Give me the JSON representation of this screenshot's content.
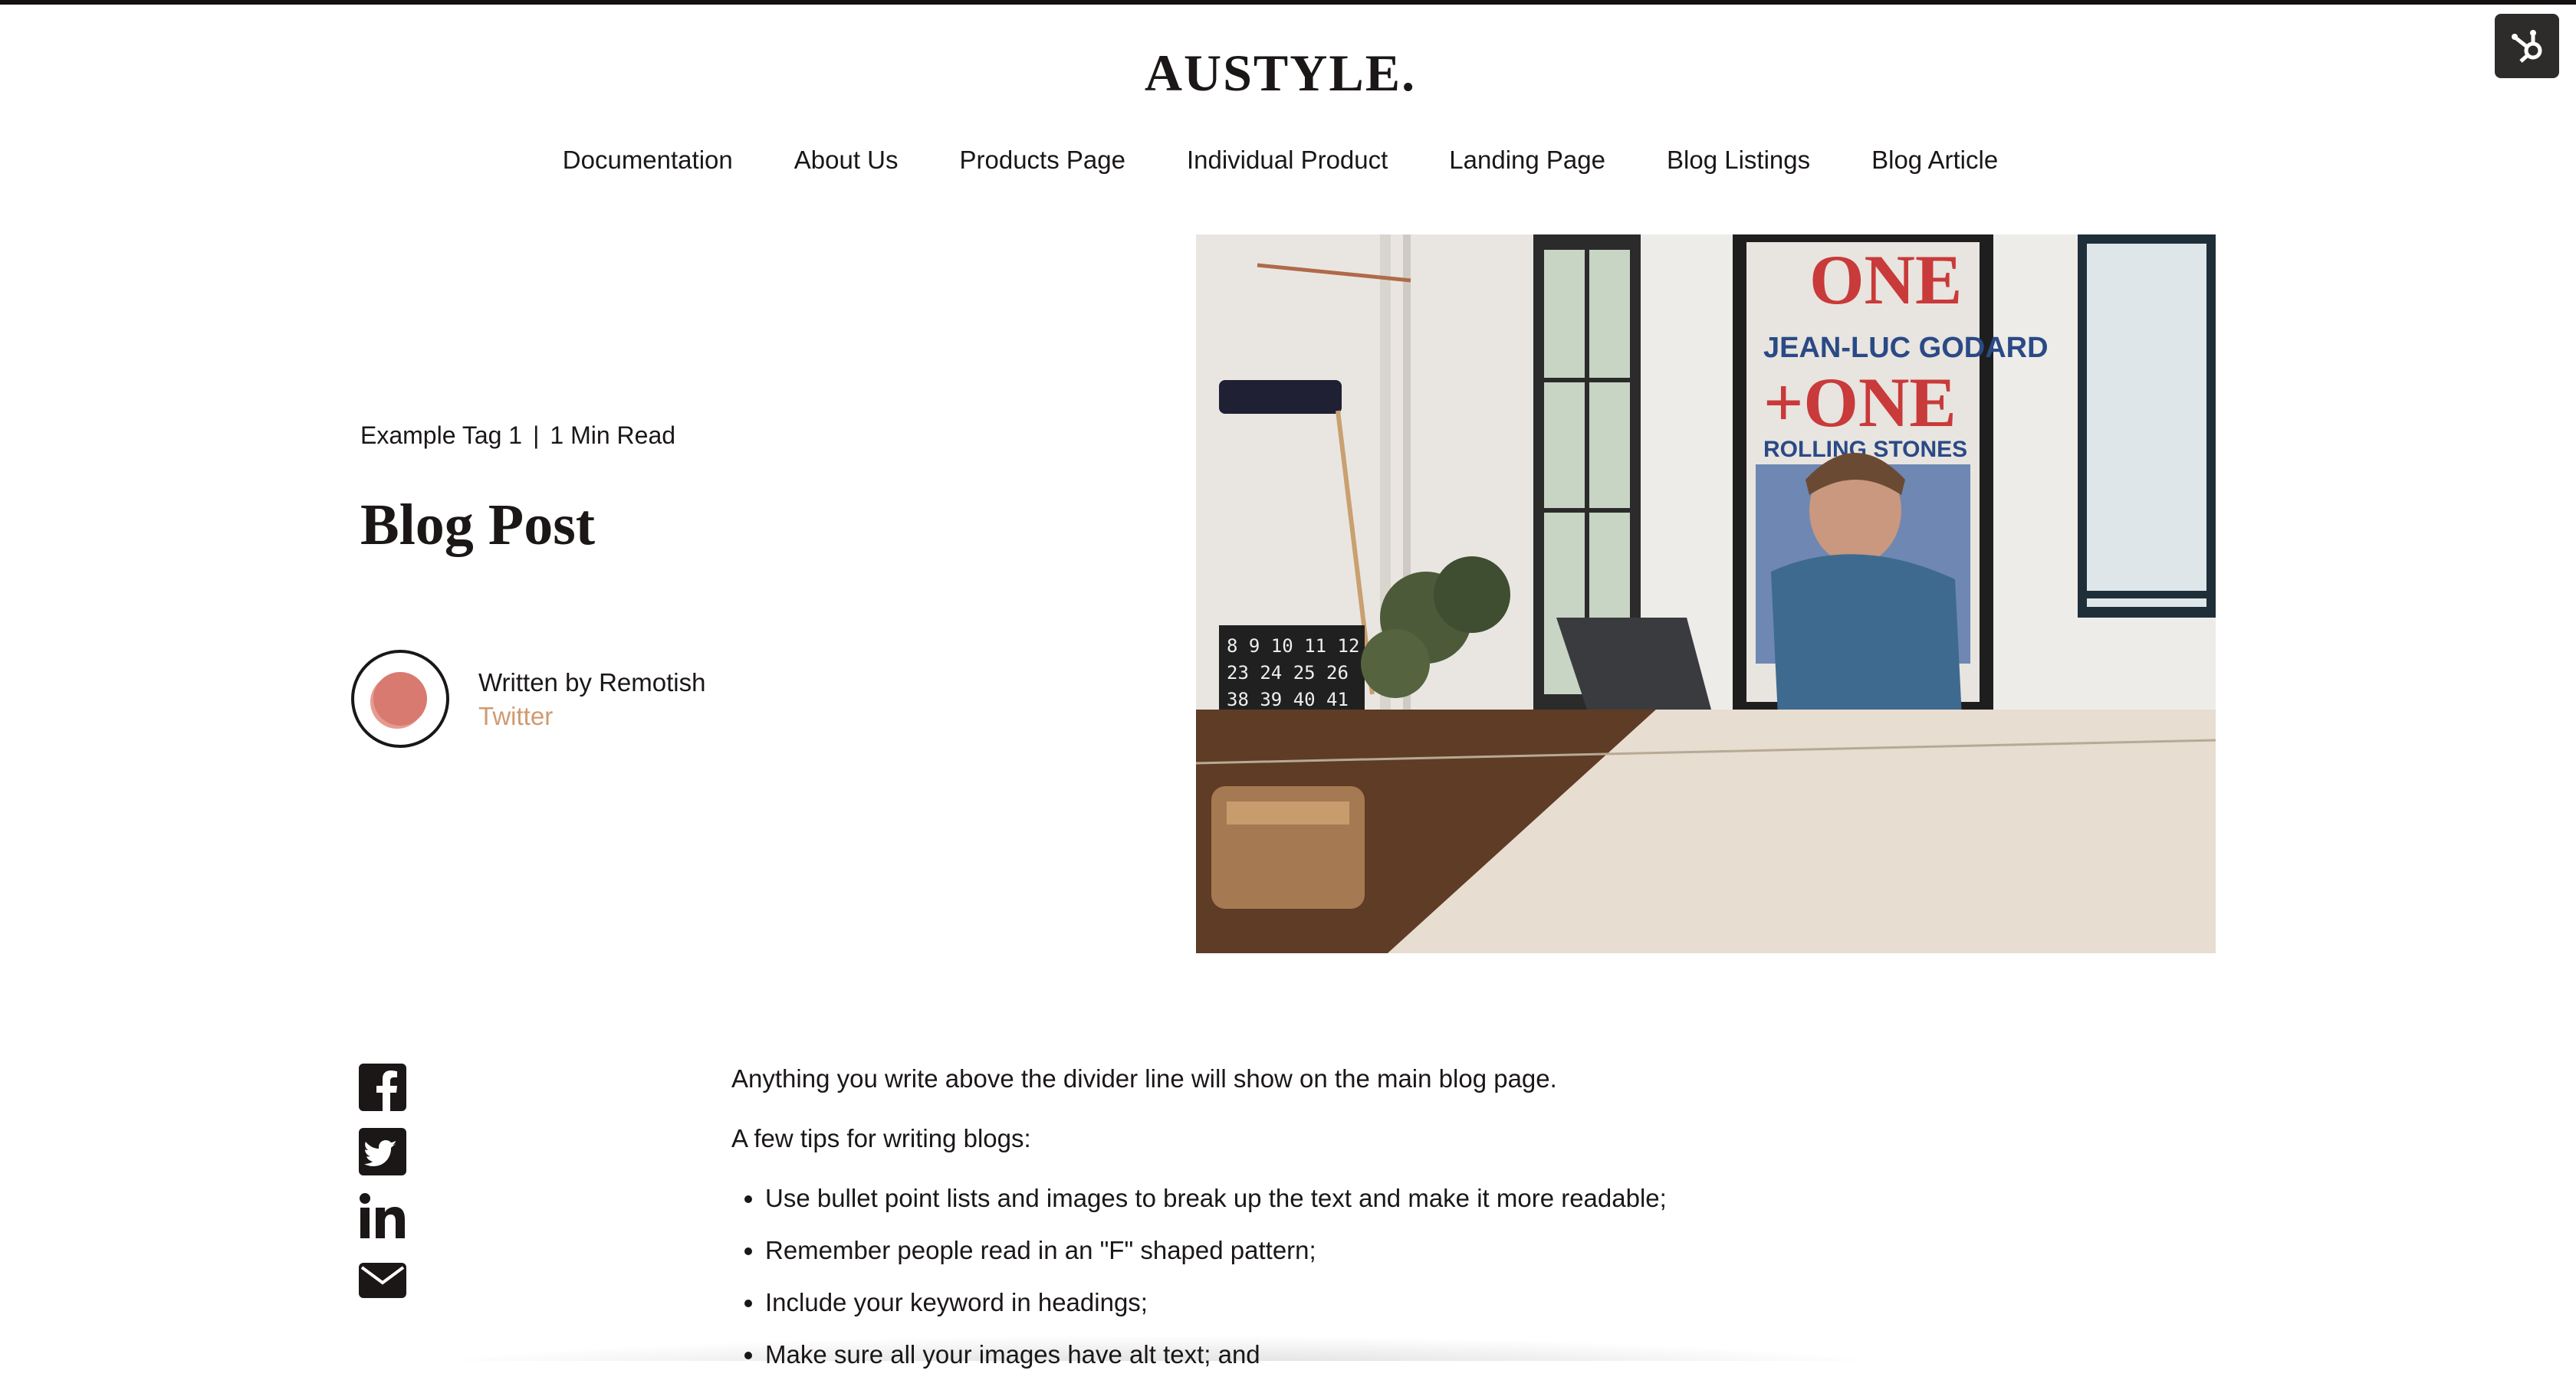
{
  "brand": {
    "logo_text": "AUSTYLE."
  },
  "hubspot": {
    "icon": "hubspot-sprocket-icon"
  },
  "nav": {
    "items": [
      {
        "label": "Documentation"
      },
      {
        "label": "About Us"
      },
      {
        "label": "Products Page"
      },
      {
        "label": "Individual Product"
      },
      {
        "label": "Landing Page"
      },
      {
        "label": "Blog Listings"
      },
      {
        "label": "Blog Article"
      }
    ]
  },
  "post": {
    "tag": "Example Tag 1",
    "separator": "|",
    "read_time": "1 Min Read",
    "title": "Blog Post",
    "author": "Written by Remotish",
    "author_link": "Twitter",
    "hero_image": "Man working on laptop at wooden table in bright loft office with 'ONE + ONE' poster"
  },
  "share": {
    "icons": [
      "facebook-icon",
      "twitter-icon",
      "linkedin-icon",
      "email-icon"
    ]
  },
  "body": {
    "intro": "Anything you write above the divider line will show on the main blog page.",
    "tips_heading": "A few tips for writing blogs:",
    "tips": [
      "Use bullet point lists and images to break up the text and make it more readable;",
      "Remember people read in an \"F\" shaped pattern;",
      "Include your keyword in headings;",
      "Make sure all your images have alt text; and"
    ]
  },
  "colors": {
    "text": "#1b1717",
    "accent_link": "#d09a70",
    "avatar_fill": "#d97a70",
    "hubspot_button": "#2e2b2b"
  }
}
